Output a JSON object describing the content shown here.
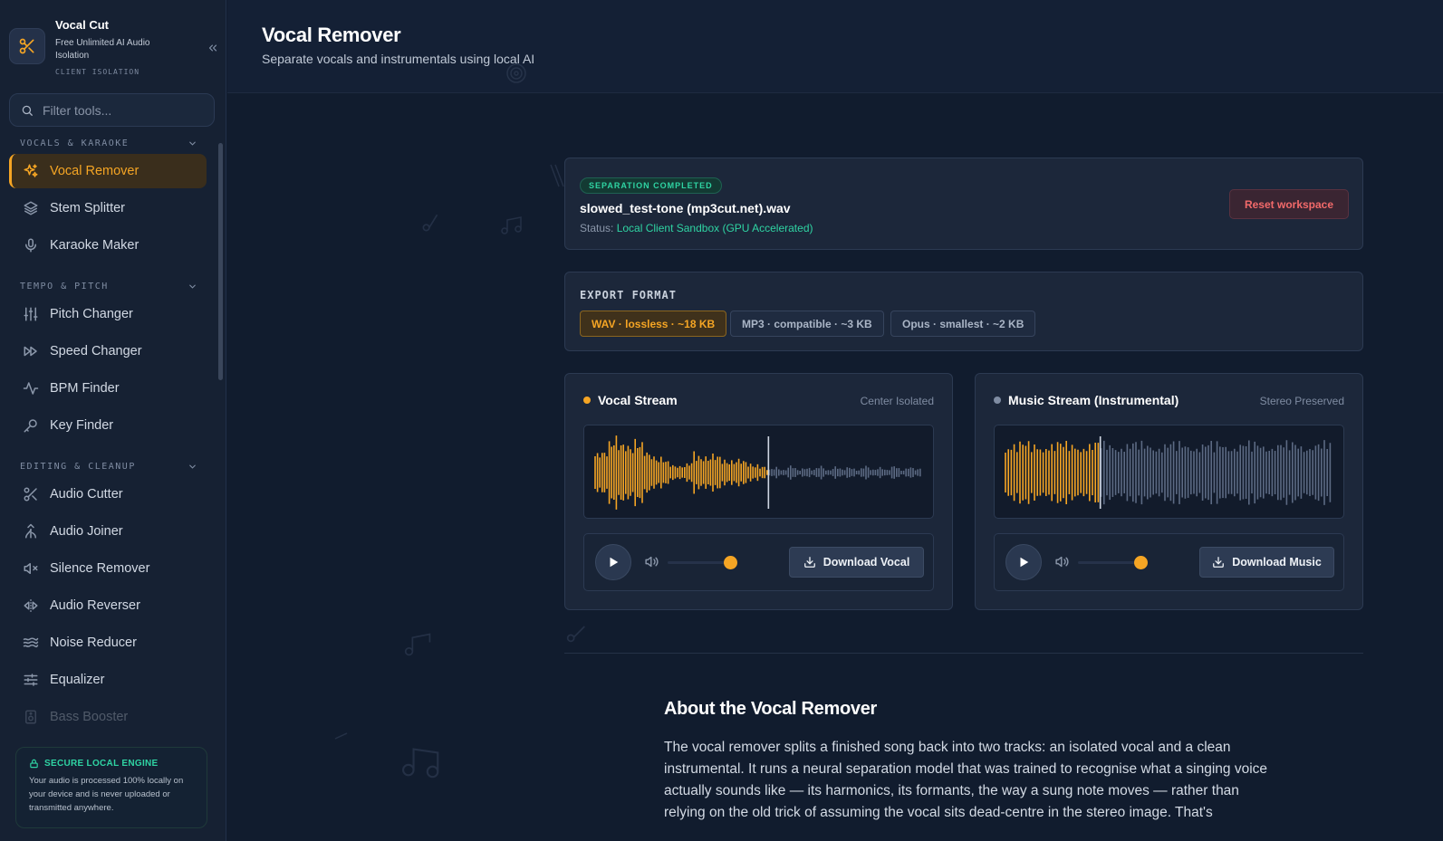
{
  "colors": {
    "accent": "#f5a524",
    "success": "#2fd4a3",
    "danger": "#f26a6a",
    "background": "#111c2e",
    "card": "#1c273a",
    "muted_wave": "#5c6a83"
  },
  "brand": {
    "title": "Vocal Cut",
    "subtitle": "Free Unlimited AI Audio Isolation",
    "tag": "CLIENT ISOLATION",
    "logo_icon": "scissors-icon",
    "collapse_icon": "chevrons-left-icon"
  },
  "search": {
    "placeholder": "Filter tools...",
    "value": ""
  },
  "sidebar": {
    "sections": [
      {
        "title": "VOCALS & KARAOKE",
        "items": [
          {
            "label": "Vocal Remover",
            "icon": "sparkles-icon",
            "active": true
          },
          {
            "label": "Stem Splitter",
            "icon": "layers-icon"
          },
          {
            "label": "Karaoke Maker",
            "icon": "microphone-icon"
          }
        ]
      },
      {
        "title": "TEMPO & PITCH",
        "items": [
          {
            "label": "Pitch Changer",
            "icon": "sliders-vertical-icon"
          },
          {
            "label": "Speed Changer",
            "icon": "fast-forward-icon"
          },
          {
            "label": "BPM Finder",
            "icon": "activity-icon"
          },
          {
            "label": "Key Finder",
            "icon": "key-icon"
          }
        ]
      },
      {
        "title": "EDITING & CLEANUP",
        "items": [
          {
            "label": "Audio Cutter",
            "icon": "scissors-icon"
          },
          {
            "label": "Audio Joiner",
            "icon": "merge-icon"
          },
          {
            "label": "Silence Remover",
            "icon": "volume-x-icon"
          },
          {
            "label": "Audio Reverser",
            "icon": "flip-icon"
          },
          {
            "label": "Noise Reducer",
            "icon": "waves-icon"
          },
          {
            "label": "Equalizer",
            "icon": "sliders-horizontal-icon"
          },
          {
            "label": "Bass Booster",
            "icon": "speaker-icon"
          }
        ]
      }
    ]
  },
  "secure": {
    "title": "SECURE LOCAL ENGINE",
    "text": "Your audio is processed 100% locally on your device and is never uploaded or transmitted anywhere."
  },
  "header": {
    "title": "Vocal Remover",
    "subtitle": "Separate vocals and instrumentals using local AI"
  },
  "status": {
    "badge": "SEPARATION COMPLETED",
    "file_name": "slowed_test-tone (mp3cut.net).wav",
    "status_label": "Status:",
    "status_value": "Local Client Sandbox (GPU Accelerated)",
    "reset_label": "Reset workspace"
  },
  "export": {
    "label": "EXPORT FORMAT",
    "options": [
      {
        "label": "WAV · lossless · ~18 KB",
        "selected": true
      },
      {
        "label": "MP3 · compatible · ~3 KB",
        "selected": false
      },
      {
        "label": "Opus · smallest · ~2 KB",
        "selected": false
      }
    ]
  },
  "streams": [
    {
      "title": "Vocal Stream",
      "tag": "Center Isolated",
      "download_label": "Download Vocal",
      "progress": 0.53,
      "volume": 0.9,
      "dot_color": "#f5a524"
    },
    {
      "title": "Music Stream (Instrumental)",
      "tag": "Stereo Preserved",
      "download_label": "Download Music",
      "progress": 0.29,
      "volume": 0.9,
      "dot_color": "#7f8ca2"
    }
  ],
  "about": {
    "title": "About the Vocal Remover",
    "text": "The vocal remover splits a finished song back into two tracks: an isolated vocal and a clean instrumental. It runs a neural separation model that was trained to recognise what a singing voice actually sounds like — its harmonics, its formants, the way a sung note moves — rather than relying on the old trick of assuming the vocal sits dead-centre in the stereo image. That's"
  }
}
